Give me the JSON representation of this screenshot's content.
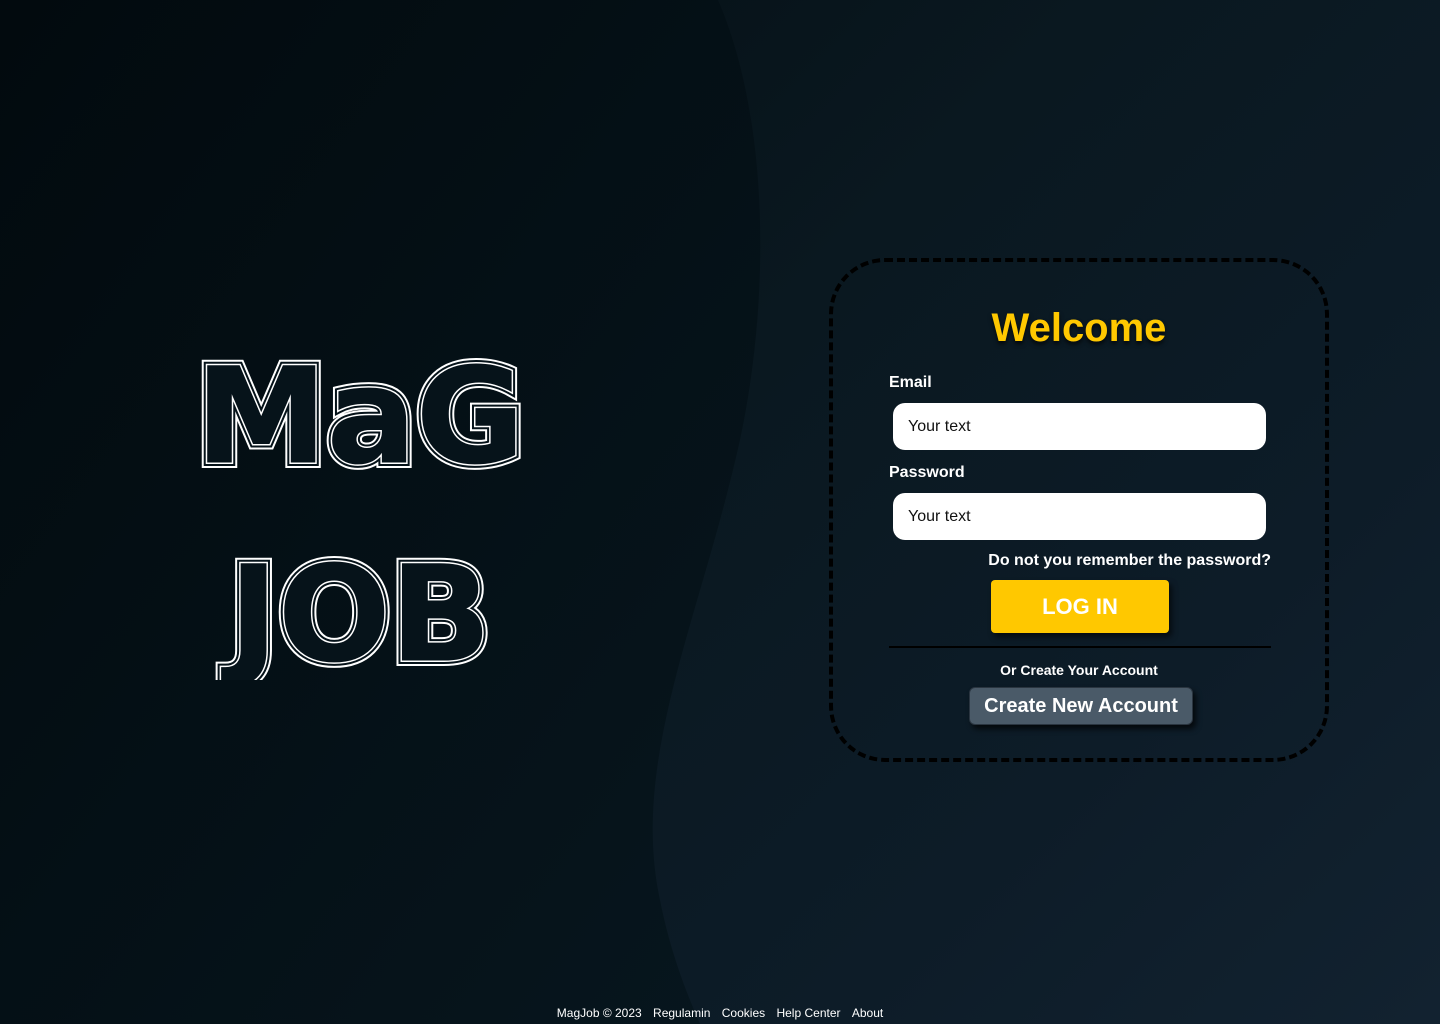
{
  "brand": {
    "line1": "MaG",
    "line2": "JOB"
  },
  "login": {
    "title": "Welcome",
    "email_label": "Email",
    "email_placeholder": "Your text",
    "password_label": "Password",
    "password_placeholder": "Your text",
    "forgot_text": "Do not you remember the password?",
    "login_button": "LOG IN",
    "or_create_text": "Or Create Your Account",
    "create_button": "Create New Account"
  },
  "footer": {
    "copyright": "MagJob © 2023",
    "links": [
      "Regulamin",
      "Cookies",
      "Help Center",
      "About"
    ]
  },
  "colors": {
    "accent": "#ffc800",
    "background": "#0a1820",
    "secondary_button": "#4a5a68"
  }
}
